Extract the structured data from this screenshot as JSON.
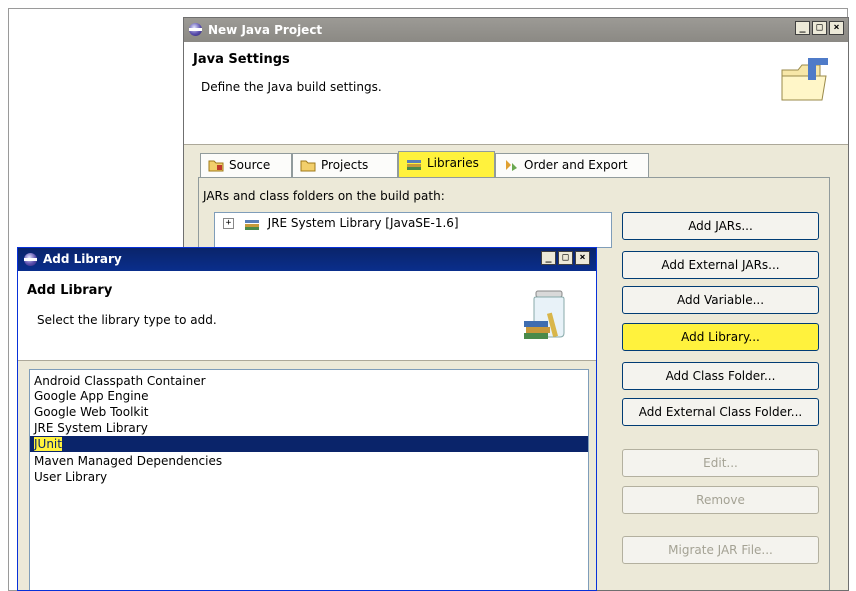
{
  "new_project": {
    "title": "New Java Project",
    "heading": "Java Settings",
    "subtitle": "Define the Java build settings.",
    "tabs": [
      {
        "label": "Source"
      },
      {
        "label": "Projects"
      },
      {
        "label": "Libraries",
        "selected": true
      },
      {
        "label": "Order and Export"
      }
    ],
    "build_path_label": "JARs and class folders on the build path:",
    "tree_items": [
      "JRE System Library [JavaSE-1.6]"
    ],
    "buttons": [
      {
        "label": "Add JARs...",
        "enabled": true
      },
      {
        "label": "Add External JARs...",
        "enabled": true
      },
      {
        "label": "Add Variable...",
        "enabled": true
      },
      {
        "label": "Add Library...",
        "enabled": true,
        "highlighted": true
      },
      {
        "label": "Add Class Folder...",
        "enabled": true
      },
      {
        "label": "Add External Class Folder...",
        "enabled": true
      },
      {
        "label": "Edit...",
        "enabled": false
      },
      {
        "label": "Remove",
        "enabled": false
      },
      {
        "label": "Migrate JAR File...",
        "enabled": false
      }
    ]
  },
  "add_library": {
    "title": "Add Library",
    "heading": "Add Library",
    "subtitle": "Select the library type to add.",
    "items": [
      "Android Classpath Container",
      "Google App Engine",
      "Google Web Toolkit",
      "JRE System Library",
      "JUnit",
      "Maven Managed Dependencies",
      "User Library"
    ],
    "selected_item": "JUnit"
  },
  "window_controls": {
    "minimize": "_",
    "maximize": "□",
    "close": "×"
  },
  "colors": {
    "highlight": "#fff23d",
    "selection": "#0a246a",
    "active_title": "#0a246a",
    "inactive_title": "#9c9a95"
  }
}
